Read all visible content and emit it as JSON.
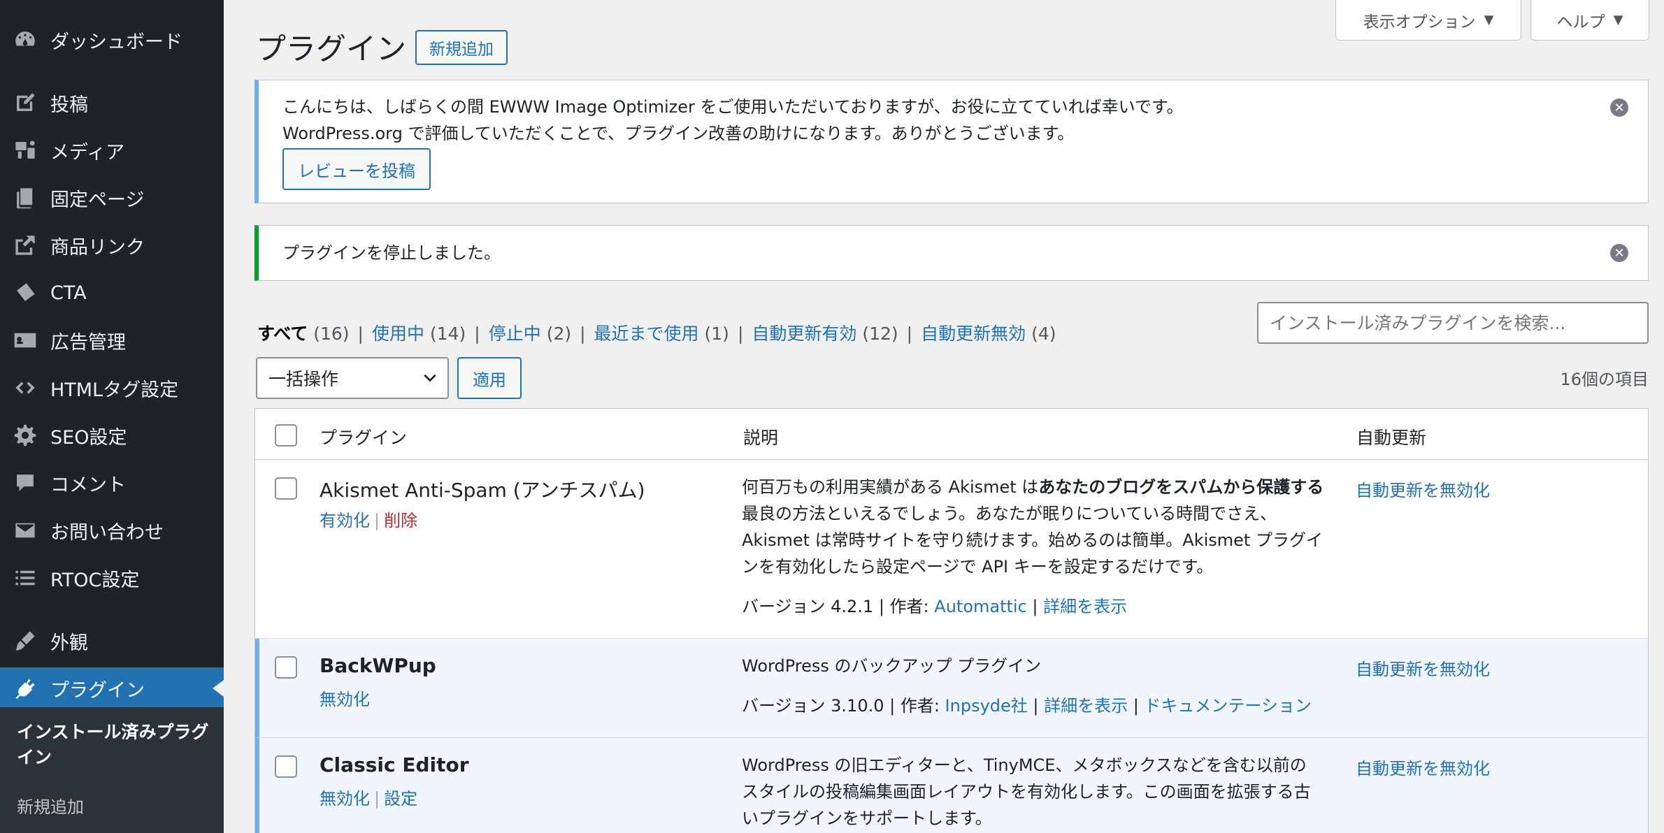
{
  "sidebar": {
    "items": [
      {
        "label": "ダッシュボード",
        "icon": "dashboard-icon"
      },
      {
        "label": "投稿",
        "icon": "post-icon"
      },
      {
        "label": "メディア",
        "icon": "media-icon"
      },
      {
        "label": "固定ページ",
        "icon": "page-icon"
      },
      {
        "label": "商品リンク",
        "icon": "external-link-icon"
      },
      {
        "label": "CTA",
        "icon": "tickets-icon"
      },
      {
        "label": "広告管理",
        "icon": "id-card-icon"
      },
      {
        "label": "HTMLタグ設定",
        "icon": "code-icon"
      },
      {
        "label": "SEO設定",
        "icon": "gear-icon"
      },
      {
        "label": "コメント",
        "icon": "comment-icon"
      },
      {
        "label": "お問い合わせ",
        "icon": "mail-icon"
      },
      {
        "label": "RTOC設定",
        "icon": "list-icon"
      },
      {
        "label": "外観",
        "icon": "brush-icon"
      },
      {
        "label": "プラグイン",
        "icon": "plugin-icon",
        "active": true
      }
    ],
    "submenu": {
      "current": "インストール済みプラグイン",
      "add_new": "新規追加"
    }
  },
  "screen_tabs": {
    "options": "表示オプション",
    "help": "ヘルプ"
  },
  "header": {
    "title": "プラグイン",
    "add_new": "新規追加"
  },
  "notices": {
    "review": {
      "line1": "こんにちは、しばらくの間 EWWW Image Optimizer をご使用いただいておりますが、お役に立てていれば幸いです。",
      "line2": "WordPress.org で評価していただくことで、プラグイン改善の助けになります。ありがとうございます。",
      "button": "レビューを投稿"
    },
    "deactivated": {
      "text": "プラグインを停止しました。"
    }
  },
  "filters": {
    "all": {
      "label": "すべて",
      "count": "(16)"
    },
    "active": {
      "label": "使用中",
      "count": "(14)"
    },
    "inactive": {
      "label": "停止中",
      "count": "(2)"
    },
    "recent": {
      "label": "最近まで使用",
      "count": "(1)"
    },
    "auto_on": {
      "label": "自動更新有効",
      "count": "(12)"
    },
    "auto_off": {
      "label": "自動更新無効",
      "count": "(4)"
    },
    "separator": "|"
  },
  "search": {
    "placeholder": "インストール済みプラグインを検索..."
  },
  "bulk": {
    "selected": "一括操作",
    "apply": "適用",
    "items_count": "16個の項目"
  },
  "table": {
    "columns": {
      "plugin": "プラグイン",
      "description": "説明",
      "auto_update": "自動更新"
    },
    "rows": [
      {
        "name": "Akismet Anti-Spam (アンチスパム)",
        "actions": [
          "有効化",
          "削除"
        ],
        "desc_pre": "何百万もの利用実績がある Akismet は",
        "desc_bold": "あなたのブログをスパムから保護する",
        "desc_line2": "最良の方法といえるでしょう。あなたが眠りについている時間でさえ、",
        "desc_line3": "Akismet は常時サイトを守り続けます。始めるのは簡単。Akismet プラグイ",
        "desc_line4": "ンを有効化したら設定ページで API キーを設定するだけです。",
        "version": "バージョン 4.2.1 | 作者: ",
        "author": "Automattic",
        "details": "詳細を表示",
        "auto_update": "自動更新を無効化"
      },
      {
        "name": "BackWPup",
        "actions": [
          "無効化"
        ],
        "desc": "WordPress のバックアップ プラグイン",
        "version": "バージョン 3.10.0 | 作者: ",
        "author": "Inpsyde社",
        "details": "詳細を表示",
        "docs": "ドキュメンテーション",
        "auto_update": "自動更新を無効化"
      },
      {
        "name": "Classic Editor",
        "actions": [
          "無効化",
          "設定"
        ],
        "desc_line1": "WordPress の旧エディターと、TinyMCE、メタボックスなどを含む以前の",
        "desc_line2": "スタイルの投稿編集画面レイアウトを有効化します。この画面を拡張する古",
        "desc_line3": "いプラグインをサポートします。",
        "auto_update": "自動更新を無効化"
      }
    ]
  },
  "colors": {
    "sidebar_bg": "#1d2327",
    "accent": "#2271b1",
    "active_row": "#f0f6fc",
    "notice_info": "#72aee6",
    "notice_success": "#00a32a",
    "delete": "#b32d2e"
  }
}
